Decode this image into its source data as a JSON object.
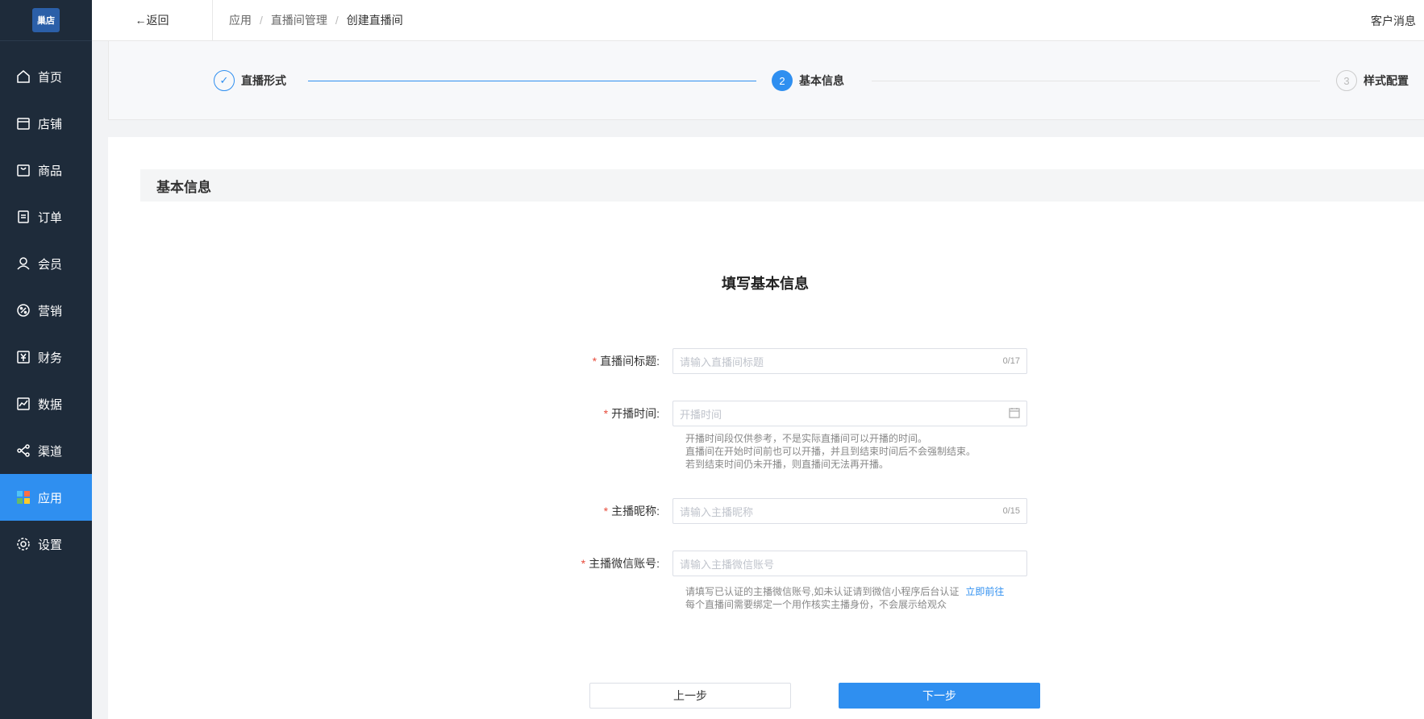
{
  "brand": {
    "logo_text": "巢店"
  },
  "sidebar": {
    "items": [
      {
        "label": "首页",
        "icon": "home-icon"
      },
      {
        "label": "店铺",
        "icon": "store-icon"
      },
      {
        "label": "商品",
        "icon": "bag-icon"
      },
      {
        "label": "订单",
        "icon": "order-icon"
      },
      {
        "label": "会员",
        "icon": "user-icon"
      },
      {
        "label": "营销",
        "icon": "marketing-icon"
      },
      {
        "label": "财务",
        "icon": "yen-icon"
      },
      {
        "label": "数据",
        "icon": "chart-icon"
      },
      {
        "label": "渠道",
        "icon": "share-icon"
      },
      {
        "label": "应用",
        "icon": "apps-icon",
        "active": true
      },
      {
        "label": "设置",
        "icon": "gear-icon"
      }
    ]
  },
  "header": {
    "back_label": "←返回",
    "breadcrumb": [
      "应用",
      "直播间管理",
      "创建直播间"
    ],
    "right_label": "客户消息"
  },
  "steps": [
    {
      "index": "✓",
      "label": "直播形式",
      "state": "done"
    },
    {
      "index": "2",
      "label": "基本信息",
      "state": "active"
    },
    {
      "index": "3",
      "label": "样式配置",
      "state": "todo"
    }
  ],
  "section_title": "基本信息",
  "form": {
    "title": "填写基本信息",
    "title_field": {
      "label": "直播间标题:",
      "placeholder": "请输入直播间标题",
      "count": "0/17"
    },
    "time_field": {
      "label": "开播时间:",
      "placeholder": "开播时间",
      "hints": [
        "开播时间段仅供参考，不是实际直播间可以开播的时间。",
        "直播间在开始时间前也可以开播，并且到结束时间后不会强制结束。",
        "若到结束时间仍未开播，则直播间无法再开播。"
      ]
    },
    "nickname_field": {
      "label": "主播昵称:",
      "placeholder": "请输入主播昵称",
      "count": "0/15"
    },
    "wechat_field": {
      "label": "主播微信账号:",
      "placeholder": "请输入主播微信账号",
      "hint1": "请填写已认证的主播微信账号,如未认证请到微信小程序后台认证",
      "hint_link": "立即前往",
      "hint2": "每个直播间需要绑定一个用作核实主播身份，不会展示给观众"
    }
  },
  "buttons": {
    "prev": "上一步",
    "next": "下一步"
  },
  "colors": {
    "sidebar_bg": "#1e2b3a",
    "accent": "#2f8ff0",
    "required": "#e74c3c"
  }
}
